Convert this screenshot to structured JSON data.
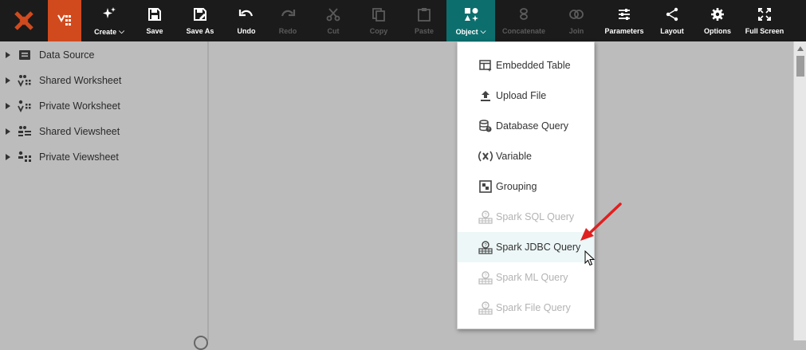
{
  "toolbar": {
    "buttons": [
      {
        "label": "Create",
        "icon": "sparkle-icon",
        "dropdown": true,
        "enabled": true
      },
      {
        "label": "Save",
        "icon": "save-icon",
        "enabled": true
      },
      {
        "label": "Save As",
        "icon": "save-as-icon",
        "enabled": true
      },
      {
        "label": "Undo",
        "icon": "undo-icon",
        "enabled": true
      },
      {
        "label": "Redo",
        "icon": "redo-icon",
        "enabled": false
      },
      {
        "label": "Cut",
        "icon": "cut-icon",
        "enabled": false
      },
      {
        "label": "Copy",
        "icon": "copy-icon",
        "enabled": false
      },
      {
        "label": "Paste",
        "icon": "paste-icon",
        "enabled": false
      },
      {
        "label": "Object",
        "icon": "object-shapes-icon",
        "dropdown": true,
        "enabled": true,
        "active": true
      },
      {
        "label": "Concatenate",
        "icon": "concatenate-icon",
        "enabled": false
      },
      {
        "label": "Join",
        "icon": "join-icon",
        "enabled": false
      },
      {
        "label": "Parameters",
        "icon": "sliders-icon",
        "enabled": true
      },
      {
        "label": "Layout",
        "icon": "layout-icon",
        "enabled": true
      },
      {
        "label": "Options",
        "icon": "gear-icon",
        "enabled": true
      },
      {
        "label": "Full Screen",
        "icon": "fullscreen-icon",
        "enabled": true
      }
    ]
  },
  "tree": {
    "items": [
      {
        "label": "Data Source",
        "icon": "data-source-icon"
      },
      {
        "label": "Shared Worksheet",
        "icon": "shared-worksheet-icon"
      },
      {
        "label": "Private Worksheet",
        "icon": "private-worksheet-icon"
      },
      {
        "label": "Shared Viewsheet",
        "icon": "shared-viewsheet-icon"
      },
      {
        "label": "Private Viewsheet",
        "icon": "private-viewsheet-icon"
      }
    ]
  },
  "object_menu": {
    "items": [
      {
        "label": "Embedded Table",
        "icon": "embedded-table-icon",
        "enabled": true
      },
      {
        "label": "Upload File",
        "icon": "upload-icon",
        "enabled": true
      },
      {
        "label": "Database Query",
        "icon": "database-query-icon",
        "enabled": true
      },
      {
        "label": "Variable",
        "icon": "variable-icon",
        "enabled": true
      },
      {
        "label": "Grouping",
        "icon": "grouping-icon",
        "enabled": true
      },
      {
        "label": "Spark SQL Query",
        "icon": "spark-query-icon",
        "enabled": false
      },
      {
        "label": "Spark JDBC Query",
        "icon": "spark-query-icon",
        "enabled": true,
        "hovered": true
      },
      {
        "label": "Spark ML Query",
        "icon": "spark-query-icon",
        "enabled": false
      },
      {
        "label": "Spark File Query",
        "icon": "spark-query-icon",
        "enabled": false
      }
    ]
  },
  "colors": {
    "toolbar_bg": "#1b1b1b",
    "brand_orange": "#d14a1e",
    "active_teal": "#0d6e6e",
    "pointer_arrow": "#e02020"
  }
}
